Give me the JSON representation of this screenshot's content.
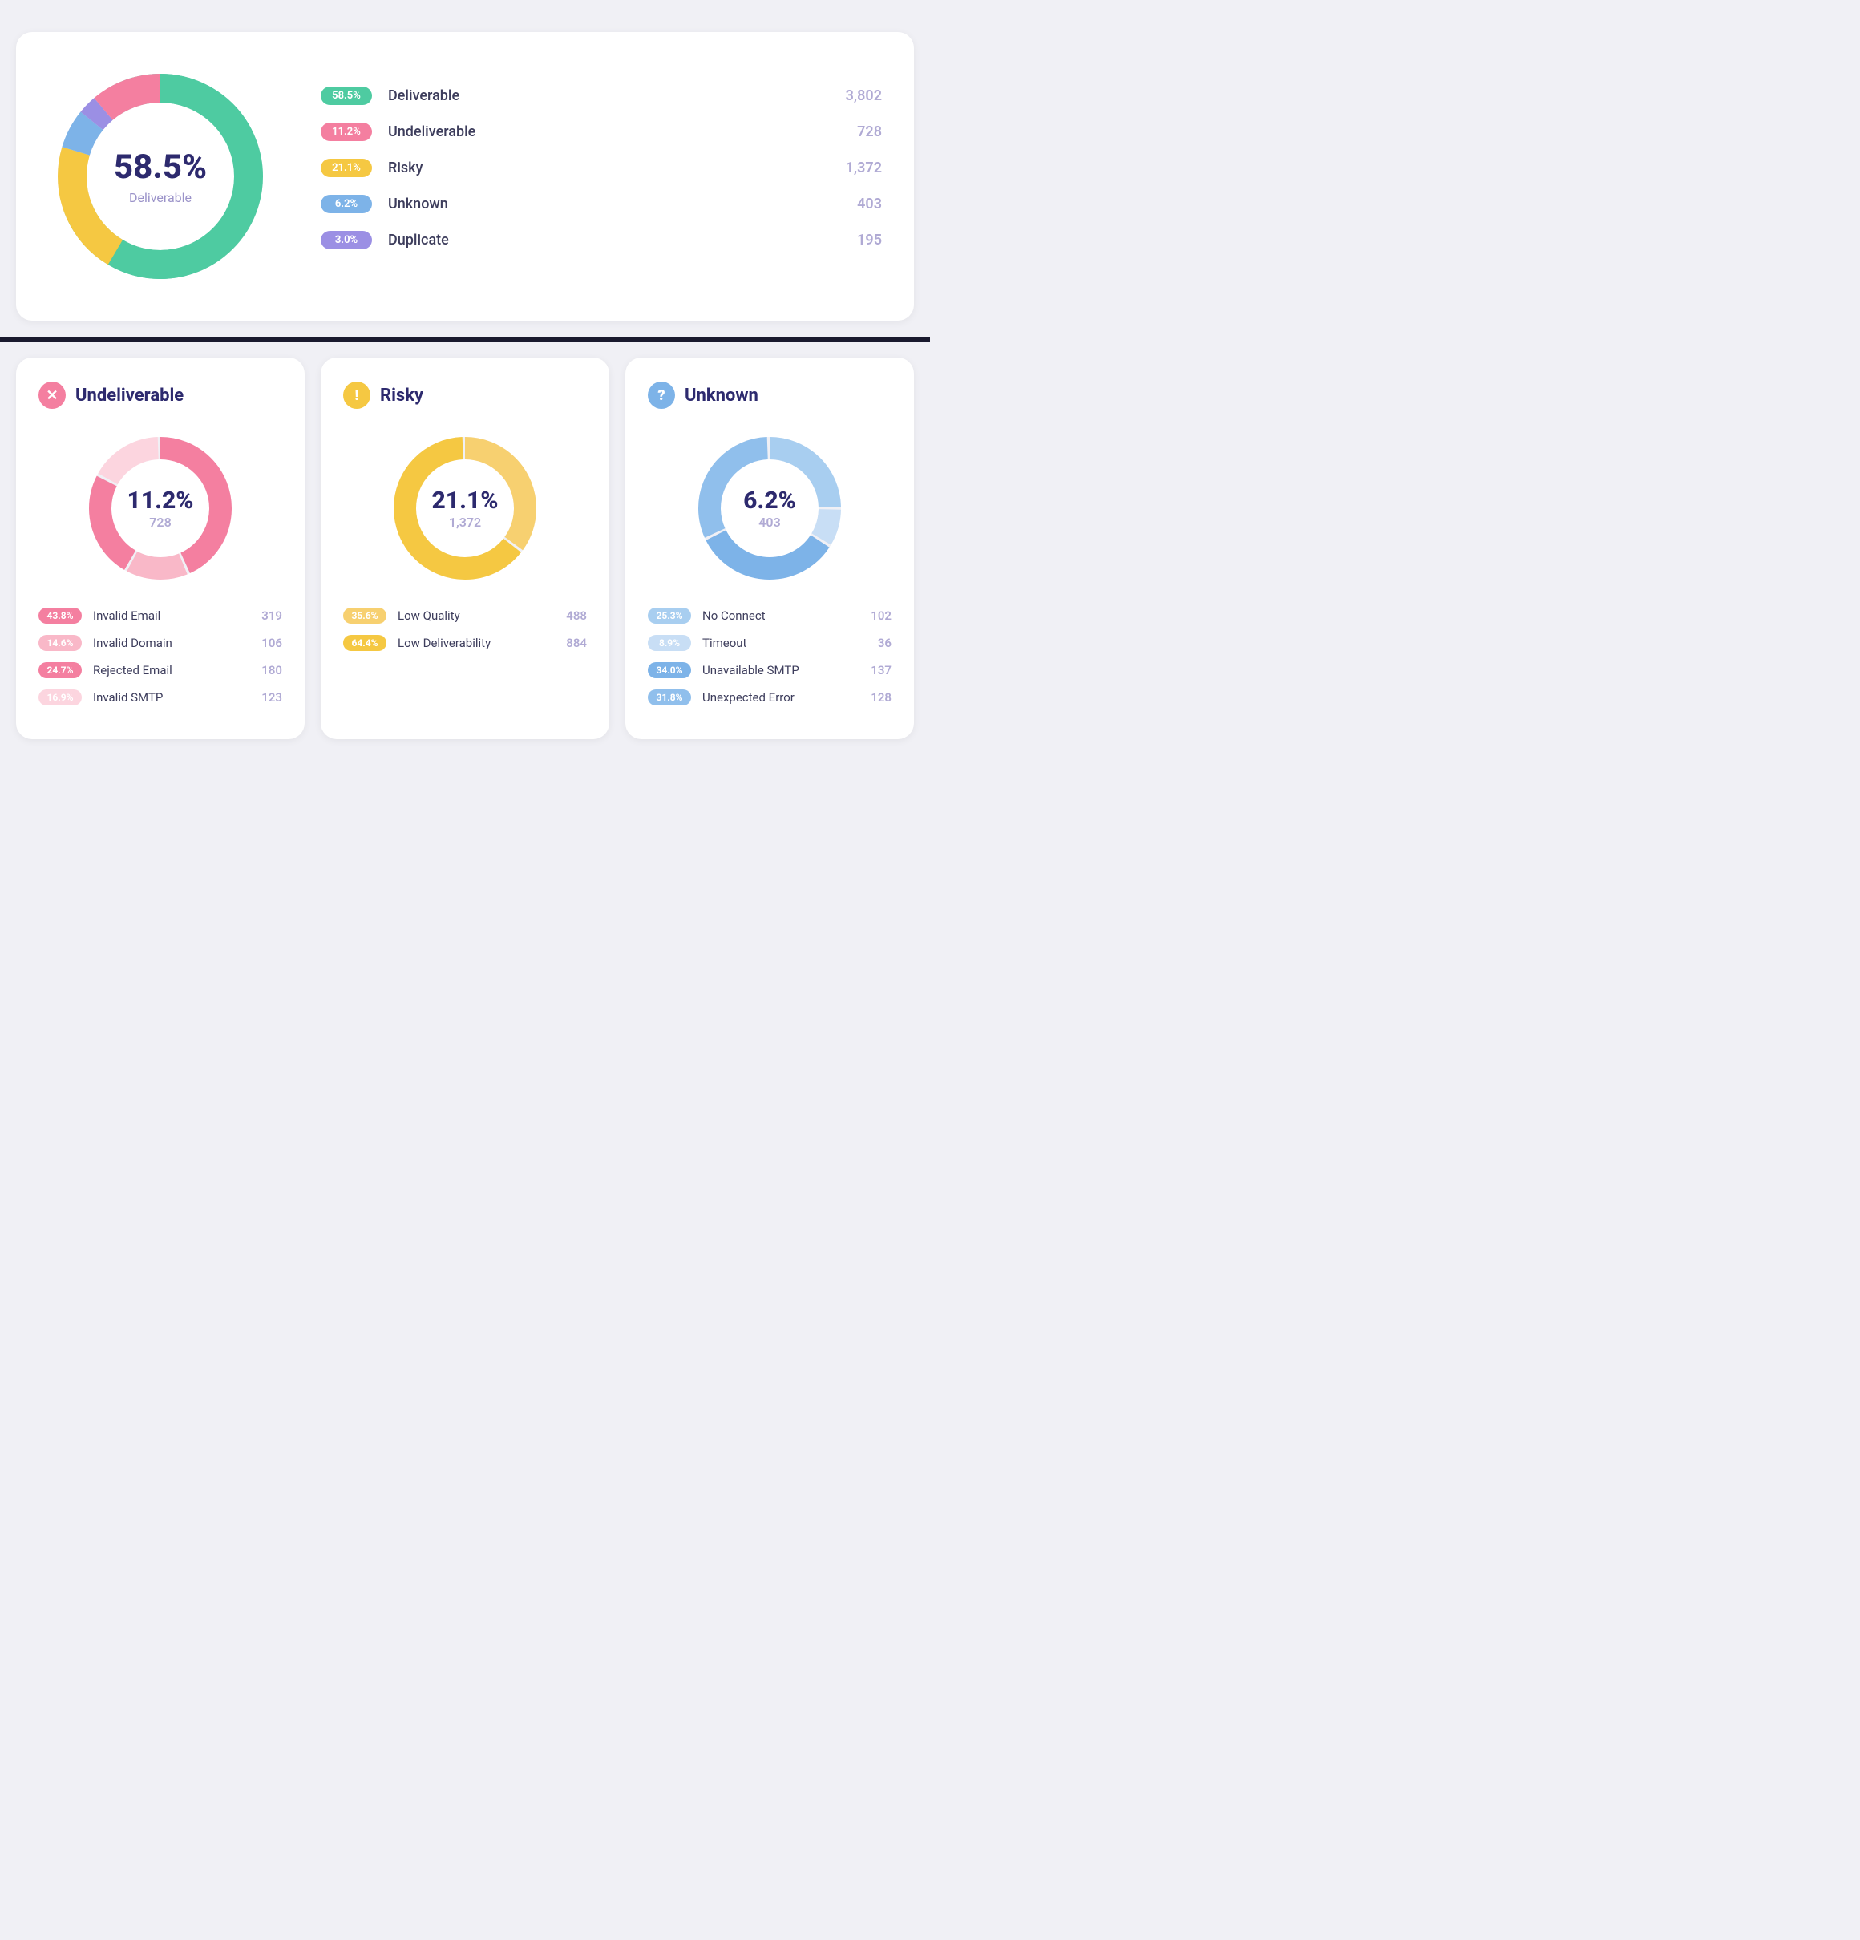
{
  "top": {
    "center_pct": "58.5%",
    "center_label": "Deliverable",
    "legend": [
      {
        "badge_text": "58.5%",
        "badge_color": "#4ecba1",
        "name": "Deliverable",
        "count": "3,802"
      },
      {
        "badge_text": "11.2%",
        "badge_color": "#f47fa0",
        "name": "Undeliverable",
        "count": "728"
      },
      {
        "badge_text": "21.1%",
        "badge_color": "#f5c842",
        "name": "Risky",
        "count": "1,372"
      },
      {
        "badge_text": "6.2%",
        "badge_color": "#7db3e8",
        "name": "Unknown",
        "count": "403"
      },
      {
        "badge_text": "3.0%",
        "badge_color": "#9b8fe4",
        "name": "Duplicate",
        "count": "195"
      }
    ]
  },
  "cards": [
    {
      "title": "Undeliverable",
      "icon_bg": "#f47fa0",
      "icon_char": "✕",
      "center_pct": "11.2%",
      "center_num": "728",
      "donut_segments": [
        {
          "pct": 43.8,
          "color": "#f47fa0"
        },
        {
          "pct": 14.6,
          "color": "#f9b8c8"
        },
        {
          "pct": 24.7,
          "color": "#f47fa0"
        },
        {
          "pct": 16.9,
          "color": "#fcd5df"
        }
      ],
      "sub_items": [
        {
          "badge_text": "43.8%",
          "badge_color": "#f47fa0",
          "name": "Invalid Email",
          "count": "319"
        },
        {
          "badge_text": "14.6%",
          "badge_color": "#f9b8c8",
          "name": "Invalid Domain",
          "count": "106"
        },
        {
          "badge_text": "24.7%",
          "badge_color": "#f47fa0",
          "name": "Rejected Email",
          "count": "180"
        },
        {
          "badge_text": "16.9%",
          "badge_color": "#fcd5df",
          "name": "Invalid SMTP",
          "count": "123"
        }
      ]
    },
    {
      "title": "Risky",
      "icon_bg": "#f5c842",
      "icon_char": "!",
      "center_pct": "21.1%",
      "center_num": "1,372",
      "donut_segments": [
        {
          "pct": 35.6,
          "color": "#f7d070"
        },
        {
          "pct": 64.4,
          "color": "#f5c842"
        }
      ],
      "sub_items": [
        {
          "badge_text": "35.6%",
          "badge_color": "#f7d070",
          "name": "Low Quality",
          "count": "488"
        },
        {
          "badge_text": "64.4%",
          "badge_color": "#f5c842",
          "name": "Low Deliverability",
          "count": "884"
        }
      ]
    },
    {
      "title": "Unknown",
      "icon_bg": "#7db3e8",
      "icon_char": "?",
      "center_pct": "6.2%",
      "center_num": "403",
      "donut_segments": [
        {
          "pct": 25.3,
          "color": "#a8cef0"
        },
        {
          "pct": 8.9,
          "color": "#c8def5"
        },
        {
          "pct": 34.0,
          "color": "#7db3e8"
        },
        {
          "pct": 31.8,
          "color": "#90bfec"
        }
      ],
      "sub_items": [
        {
          "badge_text": "25.3%",
          "badge_color": "#a8cef0",
          "name": "No Connect",
          "count": "102"
        },
        {
          "badge_text": "8.9%",
          "badge_color": "#c8def5",
          "name": "Timeout",
          "count": "36"
        },
        {
          "badge_text": "34.0%",
          "badge_color": "#7db3e8",
          "name": "Unavailable SMTP",
          "count": "137"
        },
        {
          "badge_text": "31.8%",
          "badge_color": "#90bfec",
          "name": "Unexpected Error",
          "count": "128"
        }
      ]
    }
  ]
}
